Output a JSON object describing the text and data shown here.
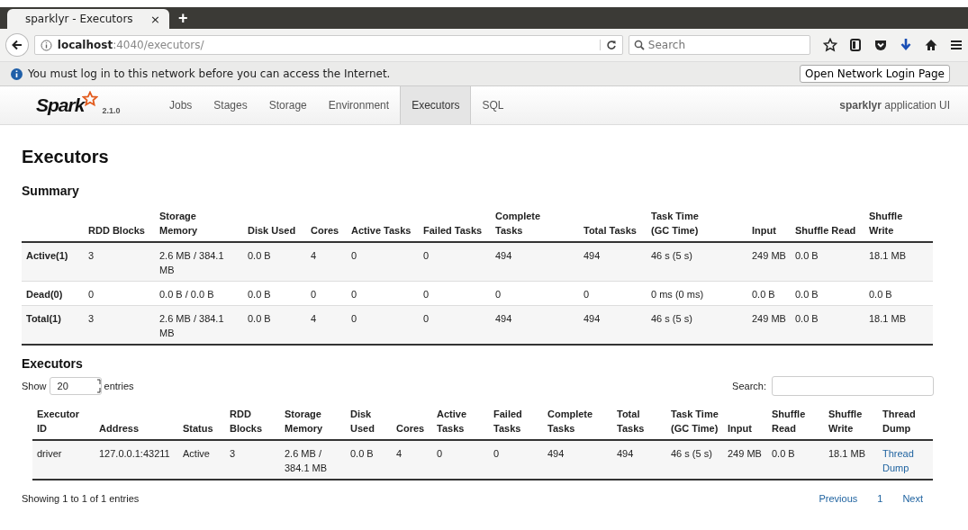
{
  "browser": {
    "tab": {
      "title": "sparklyr - Executors",
      "close": "×",
      "new_tab": "+"
    },
    "url": {
      "host": "localhost",
      "path": ":4040/executors/"
    },
    "search": {
      "placeholder": "Search"
    }
  },
  "notification": {
    "text": "You must log in to this network before you can access the Internet.",
    "button": "Open Network Login Page"
  },
  "spark_nav": {
    "logo": "Spark",
    "version": "2.1.0",
    "tabs": [
      {
        "label": "Jobs",
        "selected": false
      },
      {
        "label": "Stages",
        "selected": false
      },
      {
        "label": "Storage",
        "selected": false
      },
      {
        "label": "Environment",
        "selected": false
      },
      {
        "label": "Executors",
        "selected": true
      },
      {
        "label": "SQL",
        "selected": false
      }
    ],
    "app_name": "**sparklyr** application UI"
  },
  "title": "Executors",
  "summary": {
    "heading": "Summary",
    "columns": [
      "",
      "RDD Blocks",
      "Storage Memory",
      "Disk Used",
      "Cores",
      "Active Tasks",
      "Failed Tasks",
      "Complete Tasks",
      "Total Tasks",
      "Task Time (GC Time)",
      "Input",
      "Shuffle Read",
      "Shuffle Write"
    ],
    "rows": [
      [
        "Active(1)",
        "3",
        "2.6 MB / 384.1 MB",
        "0.0 B",
        "4",
        "0",
        "0",
        "494",
        "494",
        "46 s (5 s)",
        "249 MB",
        "0.0 B",
        "18.1 MB"
      ],
      [
        "Dead(0)",
        "0",
        "0.0 B / 0.0 B",
        "0.0 B",
        "0",
        "0",
        "0",
        "0",
        "0",
        "0 ms (0 ms)",
        "0.0 B",
        "0.0 B",
        "0.0 B"
      ],
      [
        "Total(1)",
        "3",
        "2.6 MB / 384.1 MB",
        "0.0 B",
        "4",
        "0",
        "0",
        "494",
        "494",
        "46 s (5 s)",
        "249 MB",
        "0.0 B",
        "18.1 MB"
      ]
    ]
  },
  "executors": {
    "heading": "Executors",
    "show_label": "Show",
    "page_size": "20",
    "entries_label": "entries",
    "search_label": "Search:",
    "columns": [
      "Executor ID",
      "Address",
      "Status",
      "RDD Blocks",
      "Storage Memory",
      "Disk Used",
      "Cores",
      "Active Tasks",
      "Failed Tasks",
      "Complete Tasks",
      "Total Tasks",
      "Task Time (GC Time)",
      "Input",
      "Shuffle Read",
      "Shuffle Write",
      "Thread Dump"
    ],
    "rows": [
      {
        "cells": [
          "driver",
          "127.0.0.1:43211",
          "Active",
          "3",
          "2.6 MB / 384.1 MB",
          "0.0 B",
          "4",
          "0",
          "0",
          "494",
          "494",
          "46 s (5 s)",
          "249 MB",
          "0.0 B",
          "18.1 MB"
        ],
        "thread_dump": "Thread Dump"
      }
    ],
    "info": "Showing 1 to 1 of 1 entries",
    "pagination": {
      "previous": "Previous",
      "pages": [
        "1"
      ],
      "next": "Next"
    }
  }
}
